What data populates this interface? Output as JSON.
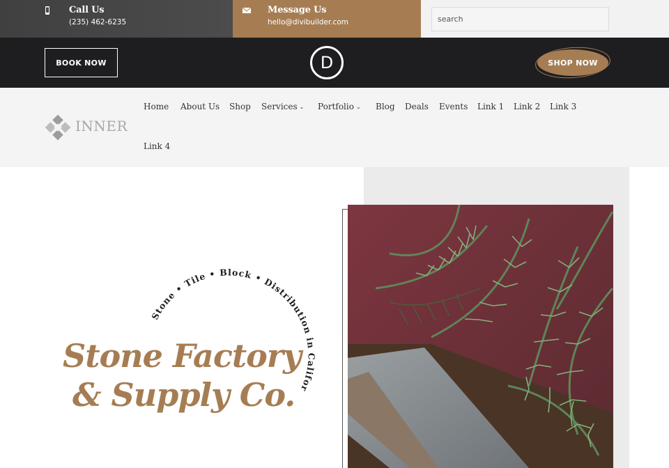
{
  "topbar": {
    "call": {
      "title": "Call Us",
      "value": "(235) 462-6235",
      "icon": "phone-icon"
    },
    "message": {
      "title": "Message Us",
      "value": "hello@divibuilder.com",
      "icon": "envelope-icon"
    },
    "search": {
      "placeholder": "search"
    }
  },
  "header": {
    "book_label": "BOOK NOW",
    "logo_letter": "D",
    "shop_label": "SHOP NOW"
  },
  "brand": {
    "name": "INNER"
  },
  "nav": {
    "items": [
      {
        "label": "Home"
      },
      {
        "label": "About Us"
      },
      {
        "label": "Shop"
      },
      {
        "label": "Services",
        "has_dropdown": true
      },
      {
        "label": "Portfolio",
        "has_dropdown": true
      },
      {
        "label": "Blog"
      },
      {
        "label": "Deals"
      },
      {
        "label": "Events"
      },
      {
        "label": "Link 1"
      },
      {
        "label": "Link 2"
      },
      {
        "label": "Link 3"
      },
      {
        "label": "Link 4"
      }
    ]
  },
  "hero": {
    "arc_text": "Stone • Tile • Block • Distribution in California",
    "title_line1": "Stone Factory",
    "title_line2": "& Supply Co."
  },
  "colors": {
    "accent": "#a67d53",
    "dark": "#1e1e20",
    "topbar_gray": "#484848",
    "nav_bg": "#f4f4f4"
  }
}
